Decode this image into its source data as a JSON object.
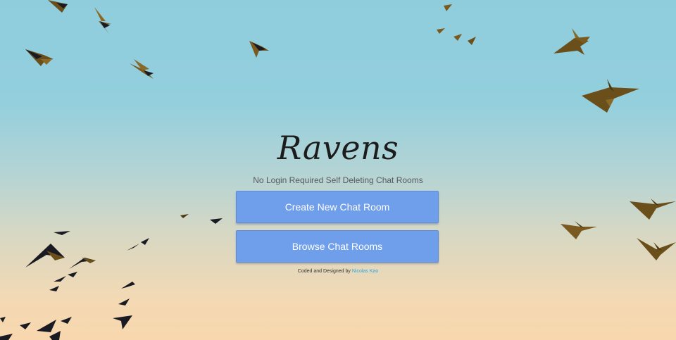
{
  "app": {
    "title": "Ravens",
    "tagline": "No Login Required Self Deleting Chat Rooms"
  },
  "actions": {
    "create_label": "Create New Chat Room",
    "browse_label": "Browse Chat Rooms"
  },
  "footer": {
    "credit_prefix": "Coded and Designed by",
    "author_link": "Nicolas Kao"
  },
  "colors": {
    "button": "#6f9eea",
    "sky_top": "#8fcddd",
    "sky_bottom": "#f8d7ae",
    "link": "#2aa6e0",
    "bird_dark": "#1a1a22",
    "bird_gold": "#7a5a1e"
  }
}
